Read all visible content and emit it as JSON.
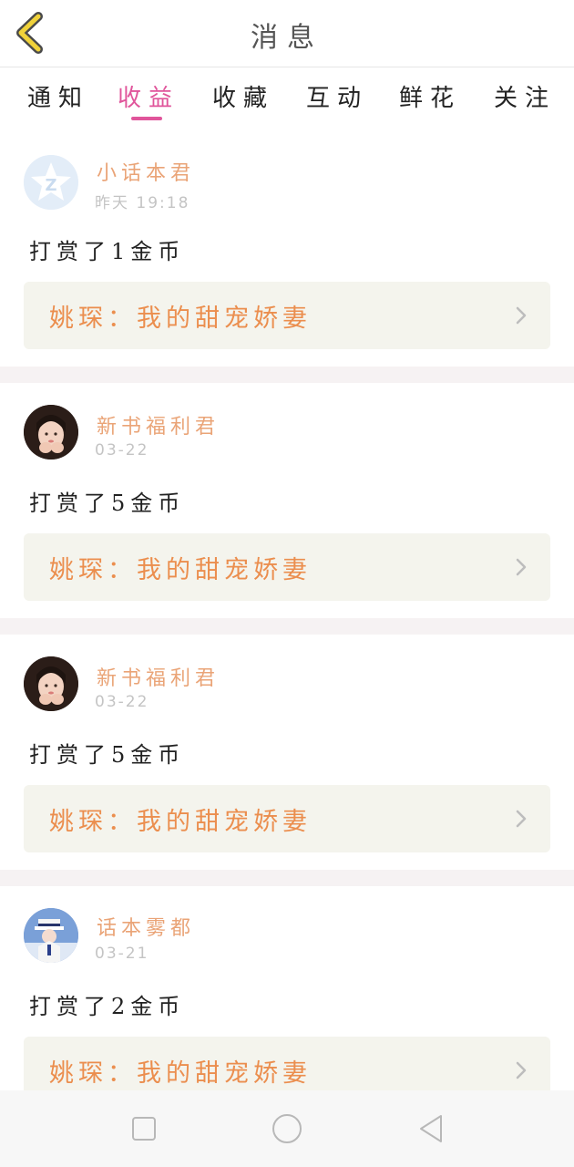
{
  "header": {
    "title": "消息"
  },
  "tabs": [
    {
      "label": "通知"
    },
    {
      "label": "收益"
    },
    {
      "label": "收藏"
    },
    {
      "label": "互动"
    },
    {
      "label": "鲜花"
    },
    {
      "label": "关注"
    }
  ],
  "active_tab_index": 1,
  "messages": [
    {
      "user": "小话本君",
      "time": "昨天 19:18",
      "text": "打赏了1金币",
      "book": "姚琛：我的甜宠娇妻",
      "avatar": "qq-zone-logo-avatar"
    },
    {
      "user": "新书福利君",
      "time": "03-22",
      "text": "打赏了5金币",
      "book": "姚琛：我的甜宠娇妻",
      "avatar": "girl-photo-avatar"
    },
    {
      "user": "新书福利君",
      "time": "03-22",
      "text": "打赏了5金币",
      "book": "姚琛：我的甜宠娇妻",
      "avatar": "girl-photo-avatar"
    },
    {
      "user": "话本雾都",
      "time": "03-21",
      "text": "打赏了2金币",
      "book": "姚琛：我的甜宠娇妻",
      "avatar": "anime-character-avatar"
    }
  ],
  "colors": {
    "accent": "#e0559b",
    "username": "#eaa477",
    "book_title": "#eb8e4e",
    "book_box_bg": "#f4f4ed",
    "divider": "#f6f2f3",
    "back_icon": "#f0d23a"
  },
  "icons": {
    "back": "chevron-left-icon",
    "item_arrow": "chevron-right-icon",
    "nav_square": "square-icon",
    "nav_circle": "circle-icon",
    "nav_triangle": "triangle-back-icon"
  }
}
